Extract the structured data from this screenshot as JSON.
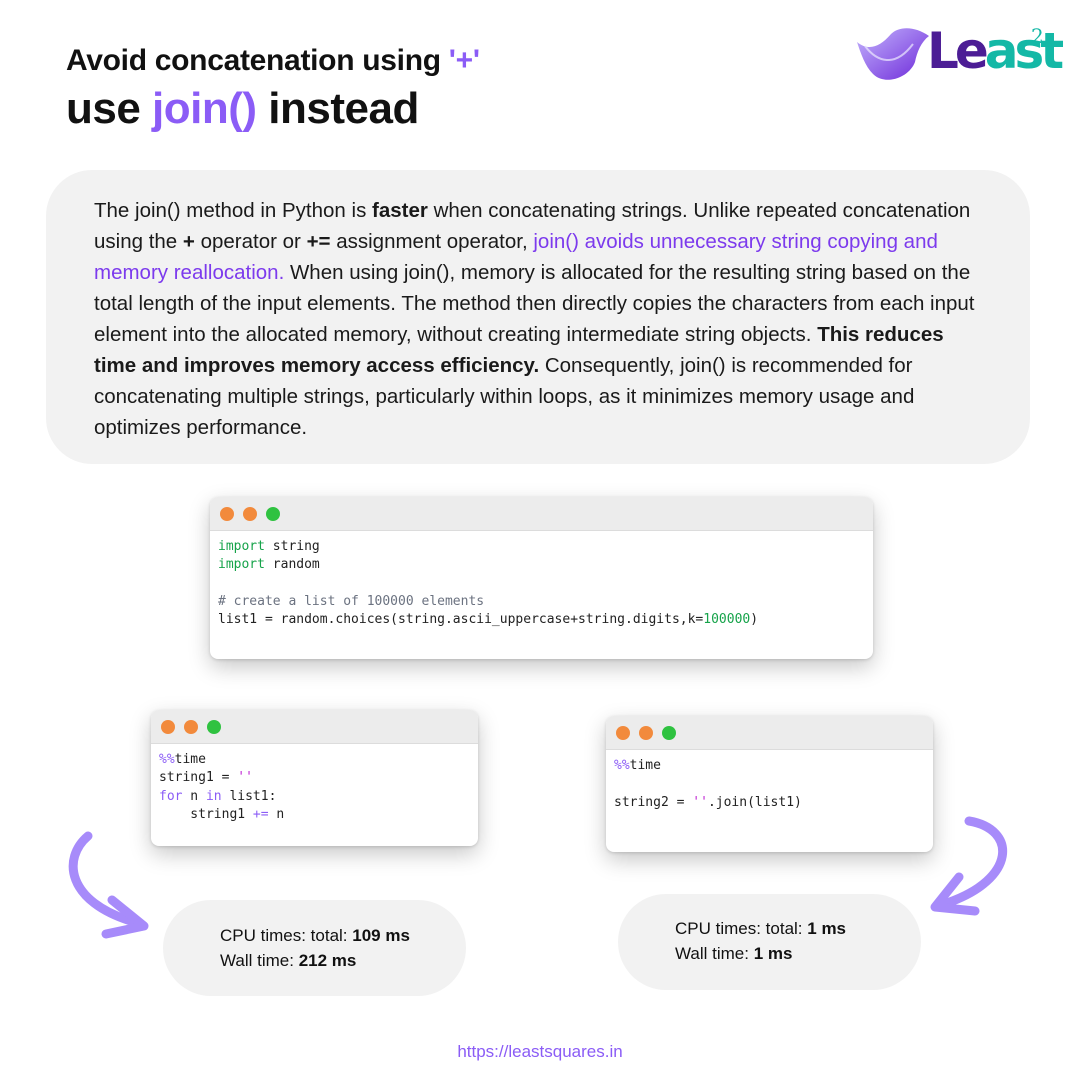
{
  "header": {
    "line1": "Avoid concatenation using ",
    "line1_op": "'+'",
    "line2_use": "use ",
    "line2_join": "join()",
    "line2_rest": " instead"
  },
  "logo": {
    "text_a": "Le",
    "text_b": "ast",
    "sup": "2"
  },
  "description": {
    "p1": "The join() method in Python is ",
    "p1_bold": "faster",
    "p2": " when concatenating strings. Unlike repeated concatenation using the ",
    "p2_plus": "+",
    "p3": " operator or ",
    "p3_pluseq": "+=",
    "p4": " assignment operator, ",
    "p4_hl": "join() avoids unnecessary string copying and memory reallocation.",
    "p5": " When using join(), memory is allocated for the resulting string based on the total length of the input elements. The method then directly copies the characters from each input element into the allocated memory, without creating intermediate string objects. ",
    "p5_bold": "This reduces time and improves memory access efficiency.",
    "p6": " Consequently, join() is recommended for concatenating multiple strings, particularly within loops, as it minimizes memory usage and optimizes performance."
  },
  "code_setup": {
    "l1_kw": "import",
    "l1_rest": " string",
    "l2_kw": "import",
    "l2_rest": " random",
    "l3": "# create a list of 100000 elements",
    "l4_a": "list1 = random.choices(string.ascii_uppercase+string.digits,k=",
    "l4_num": "100000",
    "l4_b": ")"
  },
  "code_concat": {
    "l1_magic": "%%",
    "l1_rest": "time",
    "l2_a": "string1 = ",
    "l2_str": "''",
    "l3_for": "for",
    "l3_a": " n ",
    "l3_in": "in",
    "l3_b": " list1:",
    "l4_a": "    string1 ",
    "l4_op": "+=",
    "l4_b": " n"
  },
  "code_join": {
    "l1_magic": "%%",
    "l1_rest": "time",
    "l2_a": "string2 = ",
    "l2_str": "''",
    "l2_b": ".join(list1)"
  },
  "result_concat": {
    "cpu_label": "CPU times: total: ",
    "cpu_value": "109 ms",
    "wall_label": "Wall time: ",
    "wall_value": "212 ms"
  },
  "result_join": {
    "cpu_label": "CPU times: total: ",
    "cpu_value": "1 ms",
    "wall_label": "Wall time: ",
    "wall_value": "1 ms"
  },
  "footer": {
    "url": "https://leastsquares.in"
  },
  "colors": {
    "accent": "#8b5cf6",
    "keyword": "#16a34a",
    "string": "#c026d3",
    "dot_orange": "#f28a3c",
    "dot_green": "#2fc240"
  }
}
